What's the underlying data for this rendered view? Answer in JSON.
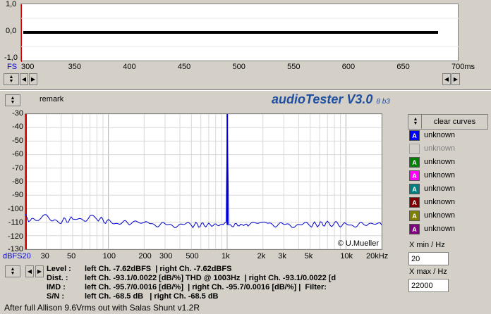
{
  "scope": {
    "y_ticks": [
      "1,0",
      "0,0",
      "-1,0"
    ],
    "fs_label": "FS",
    "x_ticks": [
      "300",
      "350",
      "400",
      "450",
      "500",
      "550",
      "600",
      "650",
      "700ms"
    ]
  },
  "header": {
    "remark_label": "remark",
    "title": "audioTester V3.0",
    "version": "8 b3"
  },
  "spectrum": {
    "y_ticks": [
      "-30",
      "-40",
      "-50",
      "-60",
      "-70",
      "-80",
      "-90",
      "-100",
      "-110",
      "-120",
      "-130"
    ],
    "x_ticks": [
      "dBFS20",
      "30",
      "50",
      "100",
      "200",
      "300",
      "500",
      "1k",
      "2k",
      "3k",
      "5k",
      "10k",
      "20kHz"
    ],
    "copyright": "© U.Mueller"
  },
  "chart_data": {
    "type": "line",
    "title": "",
    "xlabel": "",
    "ylabel": "dBFS",
    "xscale": "log",
    "xlim": [
      20,
      20000
    ],
    "ylim": [
      -130,
      -30
    ],
    "series": [
      {
        "color": "#0000cc",
        "x": [
          20,
          22,
          25,
          30,
          35,
          40,
          50,
          60,
          70,
          80,
          100,
          150,
          200,
          300,
          500,
          700,
          900,
          980,
          1003,
          1030,
          1100,
          1500,
          2000,
          3000,
          5000,
          7000,
          10000,
          15000,
          20000
        ],
        "y": [
          -104,
          -110,
          -107,
          -106,
          -108,
          -109,
          -108,
          -109,
          -106,
          -107,
          -110,
          -111,
          -111,
          -112,
          -112,
          -112,
          -112,
          -110,
          -30,
          -110,
          -112,
          -112,
          -111,
          -112,
          -112,
          -111,
          -112,
          -112,
          -112
        ]
      }
    ]
  },
  "curves": {
    "clear_label": "clear curves",
    "items": [
      {
        "glyph": "A",
        "label": "unknown",
        "color": "#0000ff",
        "enabled": true
      },
      {
        "glyph": "",
        "label": "unknown",
        "color": "#d4d0c8",
        "enabled": false
      },
      {
        "glyph": "A",
        "label": "unknown",
        "color": "#008000",
        "enabled": true
      },
      {
        "glyph": "A",
        "label": "unknown",
        "color": "#ff00ff",
        "enabled": true
      },
      {
        "glyph": "A",
        "label": "unknown",
        "color": "#008080",
        "enabled": true
      },
      {
        "glyph": "A",
        "label": "unknown",
        "color": "#800000",
        "enabled": true
      },
      {
        "glyph": "A",
        "label": "unknown",
        "color": "#808000",
        "enabled": true
      },
      {
        "glyph": "A",
        "label": "unknown",
        "color": "#800080",
        "enabled": true
      }
    ]
  },
  "xrange": {
    "min_label": "X min / Hz",
    "min_value": "20",
    "max_label": "X max / Hz",
    "max_value": "22000"
  },
  "info": {
    "lines": [
      {
        "key": "Level :",
        "value": "left Ch. -7.62dBFS  | right Ch. -7.62dBFS"
      },
      {
        "key": "Dist. :",
        "value": "left Ch. -93.1/0.0022 [dB/%] THD @ 1003Hz  | right Ch. -93.1/0.0022 [d"
      },
      {
        "key": "IMD :",
        "value": "left Ch. -95.7/0.0016 [dB/%]  | right Ch. -95.7/0.0016 [dB/%] |  Filter:"
      },
      {
        "key": "S/N :",
        "value": "left Ch. -68.5 dB   | right Ch. -68.5 dB"
      }
    ]
  },
  "status": {
    "text": "After full Allison 9.6Vrms out with Salas Shunt v1.2R"
  }
}
